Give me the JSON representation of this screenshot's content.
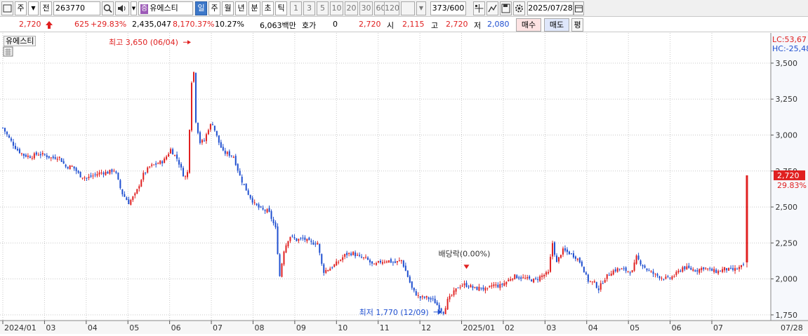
{
  "toolbar": {
    "market": "주",
    "prev": "전",
    "code": "263770",
    "badge": "증",
    "name": "유에스티",
    "periods": [
      "일",
      "주",
      "월",
      "년",
      "분",
      "초",
      "틱"
    ],
    "period_selected": "일",
    "minutes": [
      "1",
      "3",
      "5",
      "10",
      "20",
      "30",
      "60",
      "120"
    ],
    "count": "373",
    "total": "/600",
    "date": "2025/07/28"
  },
  "quote": {
    "price": "2,720",
    "change": "625",
    "change_pct": "+29.83%",
    "volume": "2,435,047",
    "volume_pct": "8,170.37%",
    "turnover": "10.27%",
    "amount": "6,063백만",
    "hoga_label": "호가",
    "hoga_qty": "0",
    "hoga_price": "2,720",
    "open_label": "시",
    "open": "2,115",
    "high_label": "고",
    "high": "2,720",
    "low_label": "저",
    "low": "2,080",
    "buy_label": "매수",
    "sell_label": "매도",
    "avg_label": "평"
  },
  "chart_tag": "유에스티",
  "chart_data": {
    "type": "candlestick",
    "title": "유에스티",
    "x_labels": [
      "2024/01",
      "03",
      "04",
      "05",
      "06",
      "07",
      "08",
      "09",
      "10",
      "11",
      "12",
      "2025/01",
      "02",
      "03",
      "04",
      "05",
      "06",
      "07",
      "07/28"
    ],
    "y_ticks": [
      "3,500",
      "3,250",
      "3,000",
      "2,750",
      "2,500",
      "2,250",
      "2,000",
      "1,750"
    ],
    "ylim": [
      1730,
      3690
    ],
    "close_points": [
      [
        0,
        3050
      ],
      [
        10,
        2970
      ],
      [
        20,
        2900
      ],
      [
        30,
        2860
      ],
      [
        40,
        2850
      ],
      [
        50,
        2870
      ],
      [
        60,
        2860
      ],
      [
        70,
        2840
      ],
      [
        80,
        2850
      ],
      [
        90,
        2780
      ],
      [
        100,
        2780
      ],
      [
        110,
        2720
      ],
      [
        120,
        2700
      ],
      [
        130,
        2720
      ],
      [
        140,
        2740
      ],
      [
        150,
        2740
      ],
      [
        160,
        2760
      ],
      [
        170,
        2600
      ],
      [
        180,
        2530
      ],
      [
        190,
        2590
      ],
      [
        200,
        2720
      ],
      [
        210,
        2780
      ],
      [
        220,
        2800
      ],
      [
        230,
        2820
      ],
      [
        240,
        2900
      ],
      [
        250,
        2830
      ],
      [
        260,
        2700
      ],
      [
        265,
        2750
      ],
      [
        268,
        3200
      ],
      [
        272,
        3550
      ],
      [
        276,
        3100
      ],
      [
        282,
        2950
      ],
      [
        288,
        2960
      ],
      [
        295,
        3060
      ],
      [
        300,
        3080
      ],
      [
        308,
        2960
      ],
      [
        315,
        2880
      ],
      [
        322,
        2870
      ],
      [
        330,
        2850
      ],
      [
        340,
        2700
      ],
      [
        350,
        2600
      ],
      [
        360,
        2520
      ],
      [
        370,
        2480
      ],
      [
        380,
        2470
      ],
      [
        390,
        2350
      ],
      [
        396,
        2020
      ],
      [
        402,
        2200
      ],
      [
        410,
        2300
      ],
      [
        420,
        2270
      ],
      [
        430,
        2280
      ],
      [
        440,
        2250
      ],
      [
        450,
        2250
      ],
      [
        458,
        2050
      ],
      [
        470,
        2080
      ],
      [
        480,
        2120
      ],
      [
        490,
        2170
      ],
      [
        500,
        2180
      ],
      [
        510,
        2150
      ],
      [
        520,
        2140
      ],
      [
        530,
        2090
      ],
      [
        540,
        2120
      ],
      [
        550,
        2130
      ],
      [
        560,
        2110
      ],
      [
        570,
        2130
      ],
      [
        578,
        2030
      ],
      [
        586,
        1920
      ],
      [
        596,
        1870
      ],
      [
        606,
        1870
      ],
      [
        616,
        1850
      ],
      [
        624,
        1800
      ],
      [
        630,
        1770
      ],
      [
        636,
        1850
      ],
      [
        644,
        1900
      ],
      [
        652,
        1950
      ],
      [
        660,
        1960
      ],
      [
        668,
        1950
      ],
      [
        676,
        1930
      ],
      [
        684,
        1940
      ],
      [
        692,
        1920
      ],
      [
        700,
        1960
      ],
      [
        710,
        1950
      ],
      [
        720,
        1980
      ],
      [
        730,
        2020
      ],
      [
        740,
        2010
      ],
      [
        750,
        2000
      ],
      [
        760,
        1990
      ],
      [
        770,
        2020
      ],
      [
        780,
        2040
      ],
      [
        786,
        2250
      ],
      [
        792,
        2110
      ],
      [
        800,
        2200
      ],
      [
        810,
        2180
      ],
      [
        820,
        2150
      ],
      [
        828,
        2100
      ],
      [
        836,
        1990
      ],
      [
        846,
        1970
      ],
      [
        852,
        1930
      ],
      [
        860,
        2000
      ],
      [
        870,
        2050
      ],
      [
        880,
        2070
      ],
      [
        890,
        2060
      ],
      [
        900,
        2050
      ],
      [
        906,
        2150
      ],
      [
        914,
        2100
      ],
      [
        922,
        2060
      ],
      [
        932,
        2030
      ],
      [
        942,
        2010
      ],
      [
        952,
        2000
      ],
      [
        962,
        2030
      ],
      [
        972,
        2080
      ],
      [
        982,
        2070
      ],
      [
        992,
        2060
      ],
      [
        1002,
        2080
      ],
      [
        1012,
        2060
      ],
      [
        1022,
        2050
      ],
      [
        1032,
        2070
      ],
      [
        1042,
        2060
      ],
      [
        1050,
        2070
      ],
      [
        1058,
        2090
      ],
      [
        1064,
        2080
      ]
    ],
    "last": {
      "open": 2115,
      "high": 2720,
      "low": 2080,
      "close": 2720
    },
    "annotations": {
      "high": "최고 3,650 (06/04)",
      "low": "최저 1,770 (12/09)",
      "dividend": "배당락(0.00%)"
    },
    "right_labels": {
      "lc": "LC:53,67",
      "hc": "HC:-25,48",
      "price": "2,720",
      "pct": "29.83%"
    },
    "colors": {
      "up": "#e02020",
      "down": "#1f4fd0",
      "grid": "#c9c9c9",
      "axis": "#555555"
    }
  }
}
